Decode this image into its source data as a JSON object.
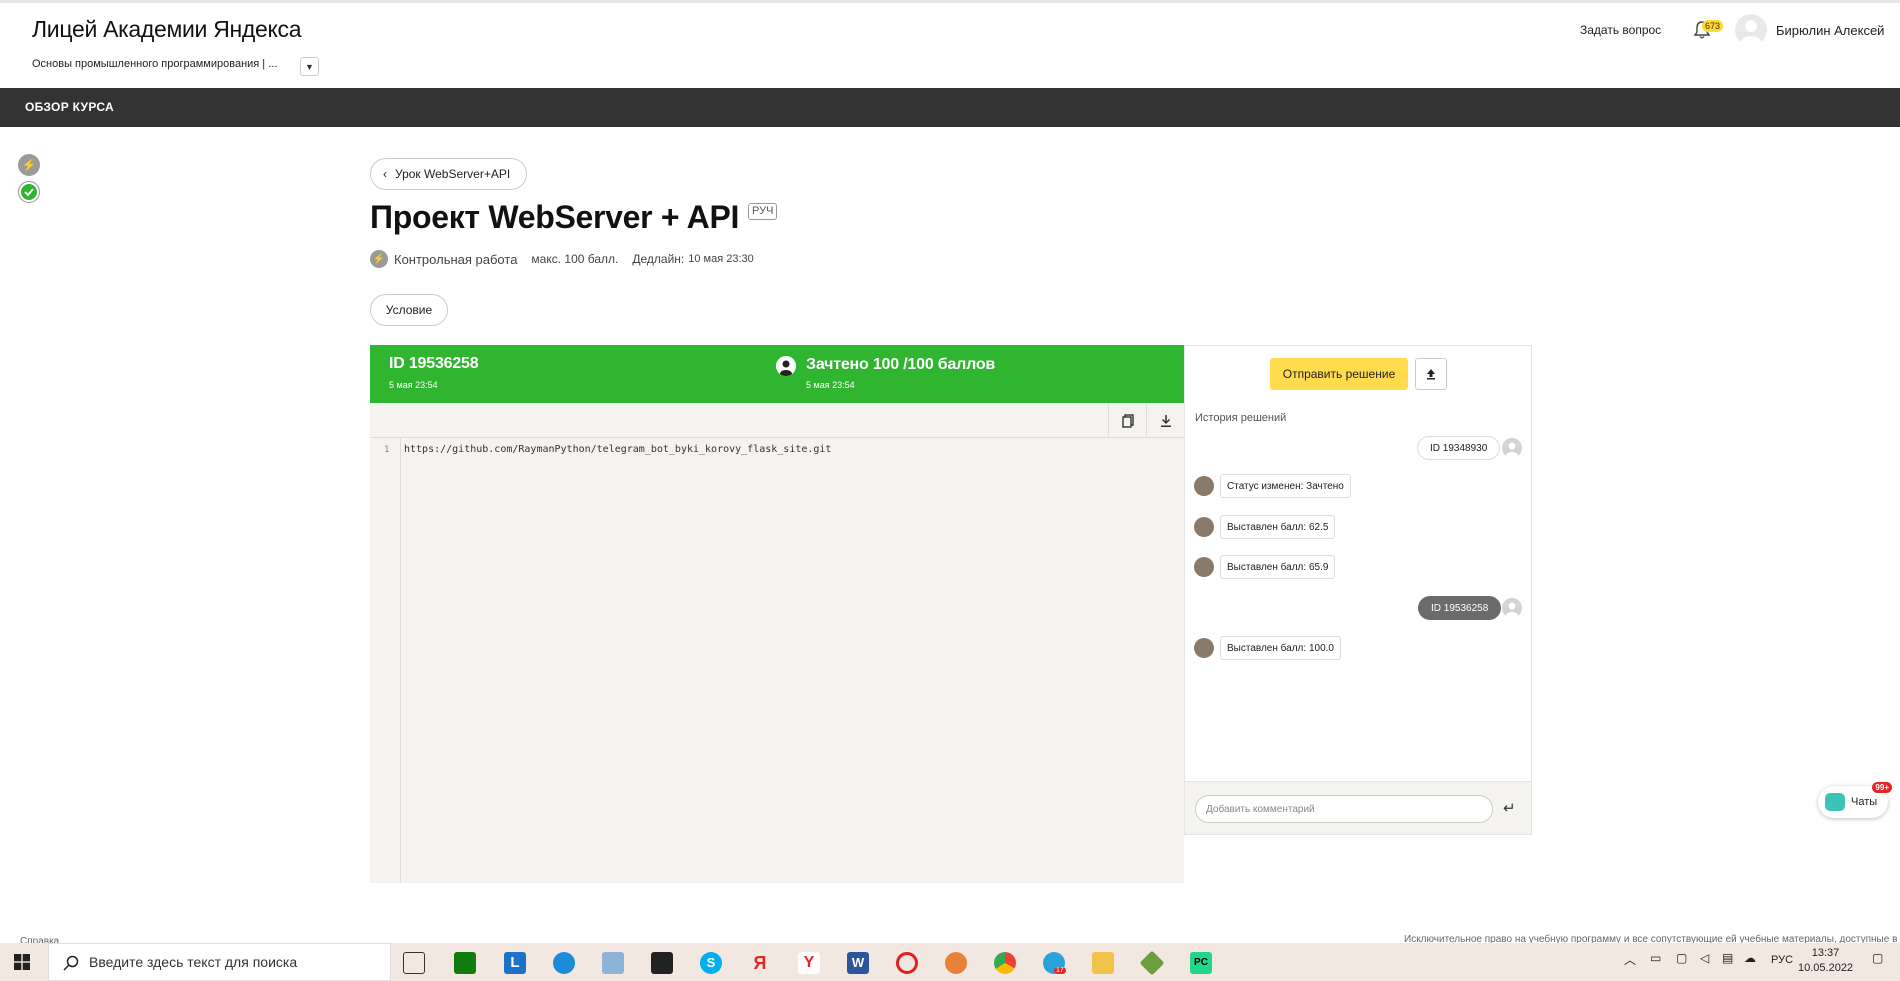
{
  "header": {
    "brand": "Лицей Академии Яндекса",
    "course": "Основы промышленного программирования | ...",
    "ask_question": "Задать вопрос",
    "notifications_count": "673",
    "user_name": "Бирюлин Алексей"
  },
  "nav": {
    "overview": "ОБЗОР КУРСА"
  },
  "page": {
    "back_label": "Урок WebServer+API",
    "title": "Проект WebServer + API",
    "badge": "РУЧ",
    "type": "Контрольная работа",
    "max_score": "макс. 100 балл.",
    "deadline_label": "Дедлайн:",
    "deadline_value": "10 мая 23:30",
    "condition_button": "Условие"
  },
  "solution": {
    "id": "ID 19536258",
    "submitted": "5 мая 23:54",
    "status": "Зачтено 100 /100 баллов",
    "status_date": "5 мая 23:54",
    "send_button": "Отправить решение",
    "line_number": "1",
    "code_line": "https://github.com/RaymanPython/telegram_bot_byki_korovy_flask_site.git"
  },
  "history": {
    "heading": "История решений",
    "items": [
      {
        "kind": "pill",
        "text": "ID 19348930"
      },
      {
        "kind": "chip",
        "text": "Статус изменен: Зачтено"
      },
      {
        "kind": "chip",
        "text": "Выставлен балл: 62.5"
      },
      {
        "kind": "chip",
        "text": "Выставлен балл: 65.9"
      },
      {
        "kind": "pill-dark",
        "text": "ID 19536258"
      },
      {
        "kind": "chip",
        "text": "Выставлен балл: 100.0"
      }
    ],
    "comment_placeholder": "Добавить комментарий"
  },
  "chats": {
    "label": "Чаты",
    "badge": "99+"
  },
  "footer": {
    "left": "Справка",
    "right": "Исключительное право на учебную программу и все сопутствующие ей учебные материалы, доступные в"
  },
  "taskbar": {
    "search_placeholder": "Введите здесь текст для поиска",
    "telegram_badge": "17",
    "lang": "РУС",
    "time": "13:37",
    "date": "10.05.2022"
  }
}
